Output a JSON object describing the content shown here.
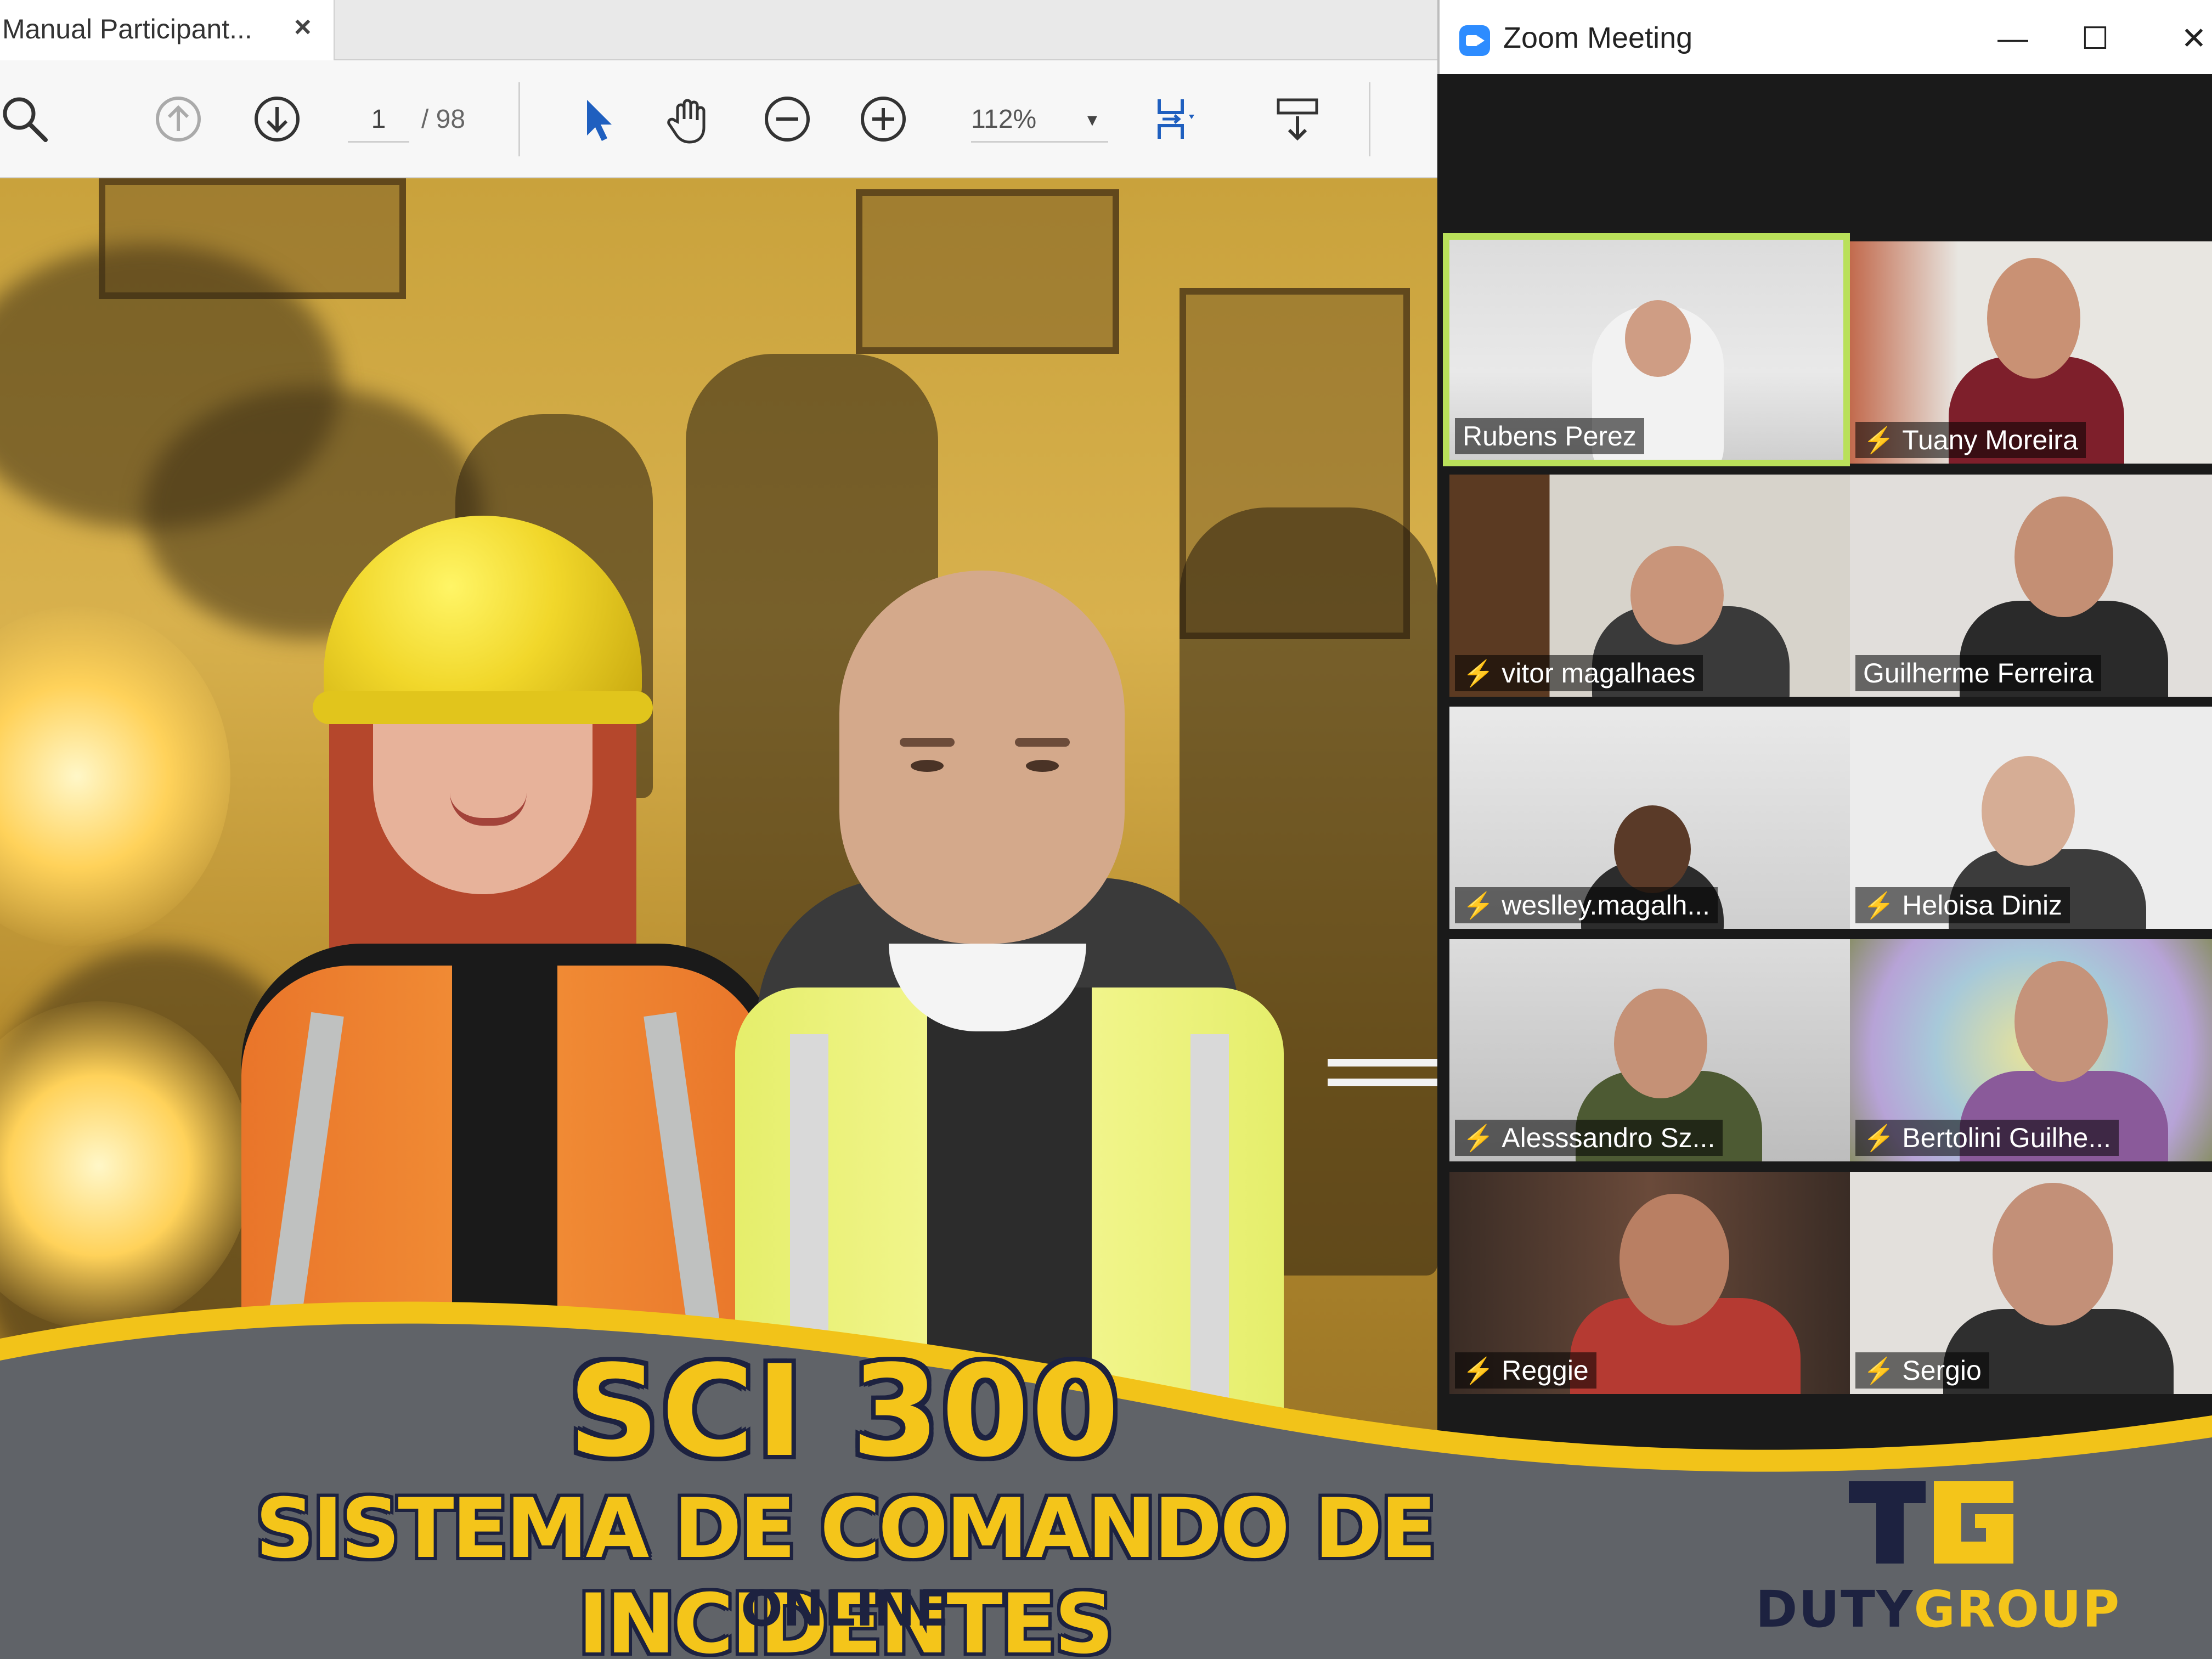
{
  "pdf_viewer": {
    "tab_title": "Manual Participant...",
    "tab_close": "×",
    "current_page": "1",
    "total_pages": "/ 98",
    "zoom_level": "112%",
    "zoom_caret": "▾",
    "toolbar_icons": [
      "search-icon",
      "page-up-icon",
      "page-down-icon",
      "select-pointer-icon",
      "hand-tool-icon",
      "zoom-out-icon",
      "zoom-in-icon",
      "fit-page-icon",
      "scroll-mode-icon"
    ]
  },
  "zoom": {
    "window_title": "Zoom Meeting",
    "minimize": "—",
    "maximize": "☐",
    "close": "✕",
    "participants": [
      {
        "name": "Rubens Perez",
        "muted": false,
        "active": true
      },
      {
        "name": "Tuany Moreira",
        "muted": true,
        "active": false
      },
      {
        "name": "vitor magalhaes",
        "muted": true,
        "active": false
      },
      {
        "name": "Guilherme Ferreira",
        "muted": false,
        "active": false
      },
      {
        "name": "weslley.magalh...",
        "muted": true,
        "active": false
      },
      {
        "name": "Heloisa Diniz",
        "muted": true,
        "active": false
      },
      {
        "name": "Alesssandro Sz...",
        "muted": true,
        "active": false
      },
      {
        "name": "Bertolini Guilhe...",
        "muted": true,
        "active": false
      },
      {
        "name": "Reggie",
        "muted": true,
        "active": false
      },
      {
        "name": "Sergio",
        "muted": true,
        "active": false
      }
    ]
  },
  "poster": {
    "title": "SCI 300",
    "subtitle": "SISTEMA DE COMANDO DE INCIDENTES",
    "mode": "ONLINE"
  },
  "brand": {
    "name_part1": "DUTY",
    "name_part2": "GROUP",
    "colors": {
      "navy": "#1d2240",
      "gold": "#f4c51a",
      "banner_gray": "#606368",
      "zoom_active_border": "#b9e05a"
    }
  }
}
